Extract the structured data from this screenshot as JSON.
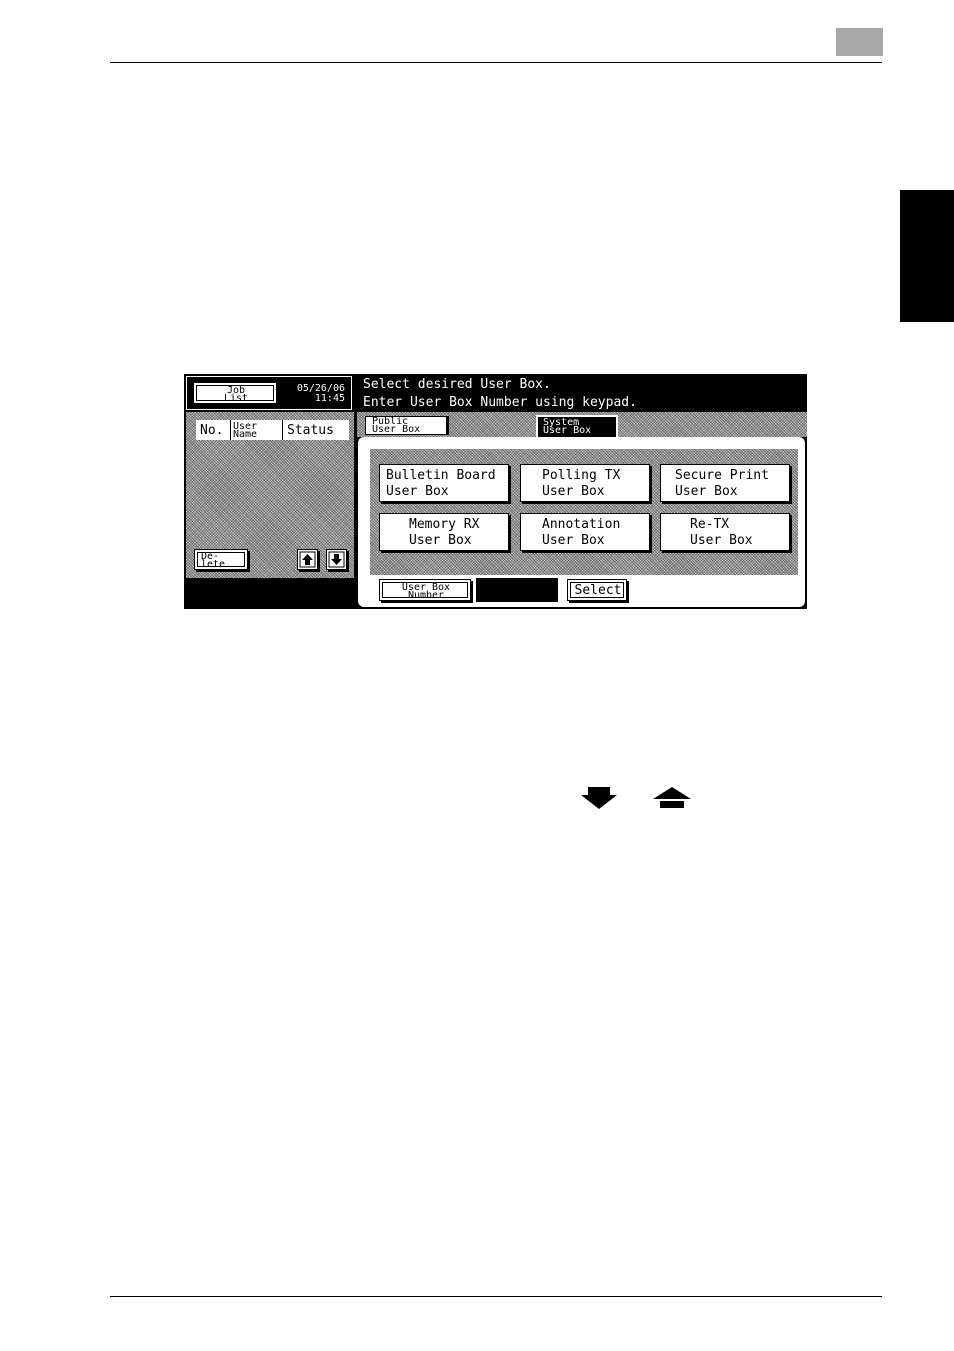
{
  "header": {
    "job_list_line1": "Job",
    "job_list_line2": "List",
    "date": "05/26/06",
    "time": "11:45"
  },
  "messages": {
    "line1": "Select desired User Box.",
    "line2": "Enter User Box Number using keypad."
  },
  "tabs": {
    "public_line1": "Public",
    "public_line2": "User Box",
    "system_line1": "System",
    "system_line2": "User Box"
  },
  "job_table": {
    "col_no": "No.",
    "col_user_line1": "User",
    "col_user_line2": "Name",
    "col_status": "Status"
  },
  "delete_button": {
    "line1": "De-",
    "line2": "lete"
  },
  "user_box_buttons": [
    {
      "line1": "Bulletin Board",
      "line2": "User Box"
    },
    {
      "line1": "Polling TX",
      "line2": "User Box"
    },
    {
      "line1": "Secure Print",
      "line2": "User Box"
    },
    {
      "line1": "Memory RX",
      "line2": "User Box"
    },
    {
      "line1": "Annotation",
      "line2": "User Box"
    },
    {
      "line1": "Re-TX",
      "line2": "User Box"
    }
  ],
  "footer": {
    "number_label_line1": "User Box",
    "number_label_line2": "Number",
    "number_value": "",
    "select_label": "Select"
  },
  "icons": {
    "scroll_up": "up-arrow-icon",
    "scroll_down": "down-arrow-icon",
    "inline_down": "down-arrow-icon",
    "inline_up": "up-arrow-icon"
  }
}
